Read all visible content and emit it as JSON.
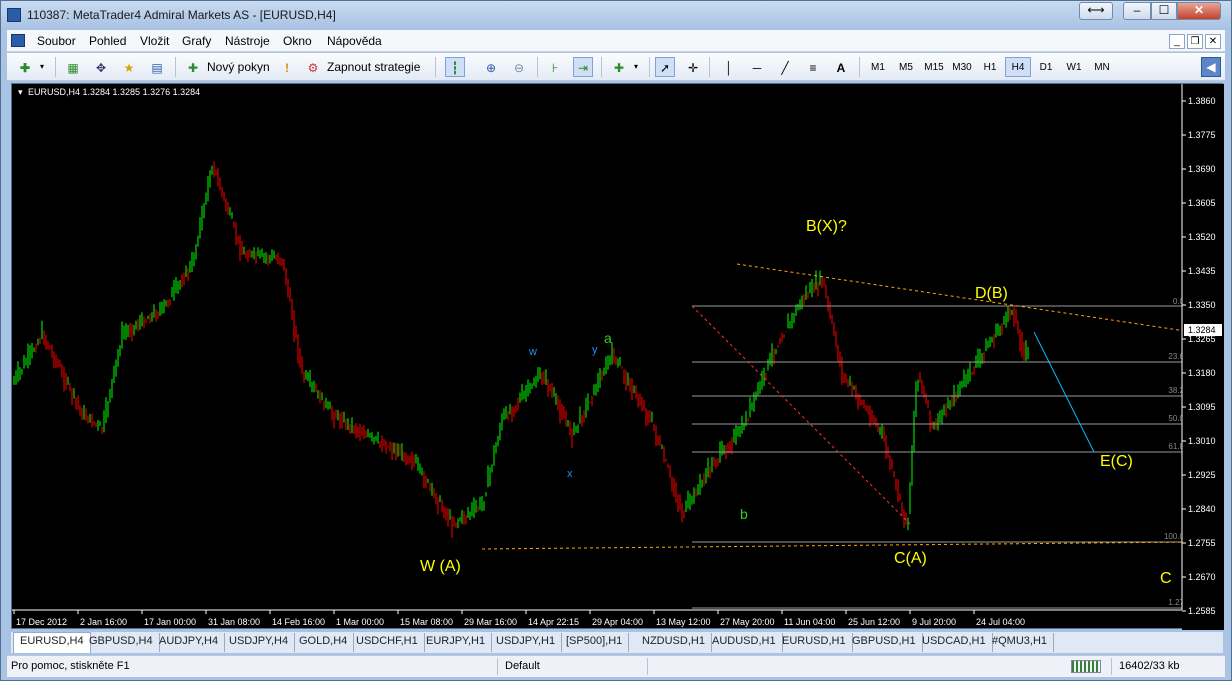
{
  "window": {
    "title": "110387: MetaTrader4 Admiral Markets AS - [EURUSD,H4]"
  },
  "menu": {
    "items": [
      "Soubor",
      "Pohled",
      "Vložit",
      "Grafy",
      "Nástroje",
      "Okno",
      "Nápověda"
    ]
  },
  "toolbar": {
    "new_order_label": "Nový pokyn",
    "strategy_label": "Zapnout strategie",
    "timeframes": [
      "M1",
      "M5",
      "M15",
      "M30",
      "H1",
      "H4",
      "D1",
      "W1",
      "MN"
    ],
    "selected_timeframe": "H4"
  },
  "chart": {
    "header": "EURUSD,H4  1.3284 1.3285 1.3276 1.3284",
    "current_price": "1.3284",
    "price_axis": [
      "1.3860",
      "1.3775",
      "1.3690",
      "1.3605",
      "1.3520",
      "1.3435",
      "1.3350",
      "1.3265",
      "1.3180",
      "1.3095",
      "1.3010",
      "1.2925",
      "1.2840",
      "1.2755",
      "1.2670",
      "1.2585"
    ],
    "time_axis": [
      "17 Dec 2012",
      "2 Jan 16:00",
      "17 Jan 00:00",
      "31 Jan 08:00",
      "14 Feb 16:00",
      "1 Mar 00:00",
      "15 Mar 08:00",
      "29 Mar 16:00",
      "14 Apr 22:15",
      "29 Apr 04:00",
      "13 May 12:00",
      "27 May 20:00",
      "11 Jun 04:00",
      "25 Jun 12:00",
      "9 Jul 20:00",
      "24 Jul 04:00"
    ],
    "fib_levels": [
      "0.0",
      "23.6",
      "38.2",
      "50.0",
      "61.8",
      "100.0",
      "1.27"
    ],
    "wave_labels": {
      "w_a": "W (A)",
      "bx": "B(X)?",
      "db": "D(B)",
      "ca": "C(A)",
      "ec": "E(C)",
      "c": "C",
      "a": "a",
      "b": "b",
      "w": "w",
      "x": "x",
      "y": "y"
    },
    "colors": {
      "bull": "#00ff00",
      "bear": "#ff0000",
      "background": "#000000",
      "labels": "#ffff00",
      "wx_labels": "#1e90ff",
      "ab_labels": "#32cd32",
      "trendline": "#ffa500",
      "projection": "#00bfff"
    }
  },
  "tabs": [
    "EURUSD,H4",
    "GBPUSD,H4",
    "AUDJPY,H4",
    "USDJPY,H4",
    "GOLD,H4",
    "USDCHF,H1",
    "EURJPY,H1",
    "USDJPY,H1",
    "[SP500],H1",
    "NZDUSD,H1",
    "AUDUSD,H1",
    "EURUSD,H1",
    "GBPUSD,H1",
    "USDCAD,H1",
    "#QMU3,H1"
  ],
  "status": {
    "help": "Pro pomoc, stiskněte F1",
    "profile": "Default",
    "traffic": "16402/33 kb"
  }
}
